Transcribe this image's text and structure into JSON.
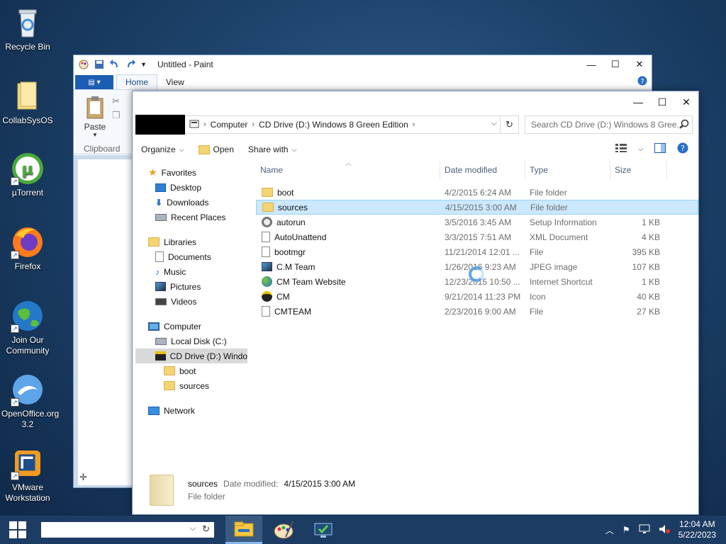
{
  "desktop": {
    "icons": [
      {
        "label": "Recycle Bin",
        "icon": "recycle-bin-icon"
      },
      {
        "label": "CollabSysOS",
        "icon": "folder-icon"
      },
      {
        "label": "µTorrent",
        "icon": "utorrent-icon"
      },
      {
        "label": "Firefox",
        "icon": "firefox-icon"
      },
      {
        "label": "Join Our Community",
        "icon": "globe-icon"
      },
      {
        "label": "OpenOffice.org 3.2",
        "icon": "openoffice-icon"
      },
      {
        "label": "VMware Workstation",
        "icon": "vmware-icon"
      }
    ]
  },
  "paint": {
    "title": "Untitled - Paint",
    "tabs": [
      "Home",
      "View"
    ],
    "ribbon": {
      "paste_label": "Paste",
      "group_label": "Clipboard"
    }
  },
  "explorer": {
    "address": {
      "crumbs": [
        "Computer",
        "CD Drive (D:) Windows 8 Green Edition"
      ]
    },
    "search_placeholder": "Search CD Drive (D:) Windows 8 Gree...",
    "commands": {
      "organize": "Organize",
      "open": "Open",
      "share_with": "Share with"
    },
    "nav": {
      "favorites": "Favorites",
      "desktop": "Desktop",
      "downloads": "Downloads",
      "recent": "Recent Places",
      "libraries": "Libraries",
      "documents": "Documents",
      "music": "Music",
      "pictures": "Pictures",
      "videos": "Videos",
      "computer": "Computer",
      "local_disk": "Local Disk (C:)",
      "cd_drive": "CD Drive (D:) Windo",
      "boot": "boot",
      "sources": "sources",
      "network": "Network"
    },
    "columns": {
      "name": "Name",
      "date": "Date modified",
      "type": "Type",
      "size": "Size"
    },
    "files": [
      {
        "name": "boot",
        "date": "4/2/2015 6:24 AM",
        "type": "File folder",
        "size": "",
        "icon": "folder-icon"
      },
      {
        "name": "sources",
        "date": "4/15/2015 3:00 AM",
        "type": "File folder",
        "size": "",
        "icon": "folder-icon"
      },
      {
        "name": "autorun",
        "date": "3/5/2016 3:45 AM",
        "type": "Setup Information",
        "size": "1 KB",
        "icon": "settings-file-icon"
      },
      {
        "name": "AutoUnattend",
        "date": "3/3/2015 7:51 AM",
        "type": "XML Document",
        "size": "4 KB",
        "icon": "xml-file-icon"
      },
      {
        "name": "bootmgr",
        "date": "11/21/2014 12:01 ...",
        "type": "File",
        "size": "395 KB",
        "icon": "file-icon"
      },
      {
        "name": "C.M Team",
        "date": "1/26/2016 9:23 AM",
        "type": "JPEG image",
        "size": "107 KB",
        "icon": "image-icon"
      },
      {
        "name": "CM Team Website",
        "date": "12/23/2015 10:50 ...",
        "type": "Internet Shortcut",
        "size": "1 KB",
        "icon": "internet-shortcut-icon"
      },
      {
        "name": "CM",
        "date": "9/21/2014 11:23 PM",
        "type": "Icon",
        "size": "40 KB",
        "icon": "cm-icon"
      },
      {
        "name": "CMTEAM",
        "date": "2/23/2016 9:00 AM",
        "type": "File",
        "size": "27 KB",
        "icon": "file-icon"
      }
    ],
    "details": {
      "name": "sources",
      "date_label": "Date modified:",
      "date_value": "4/15/2015 3:00 AM",
      "type": "File folder"
    }
  },
  "taskbar": {
    "time": "12:04 AM",
    "date": "5/22/2023"
  }
}
